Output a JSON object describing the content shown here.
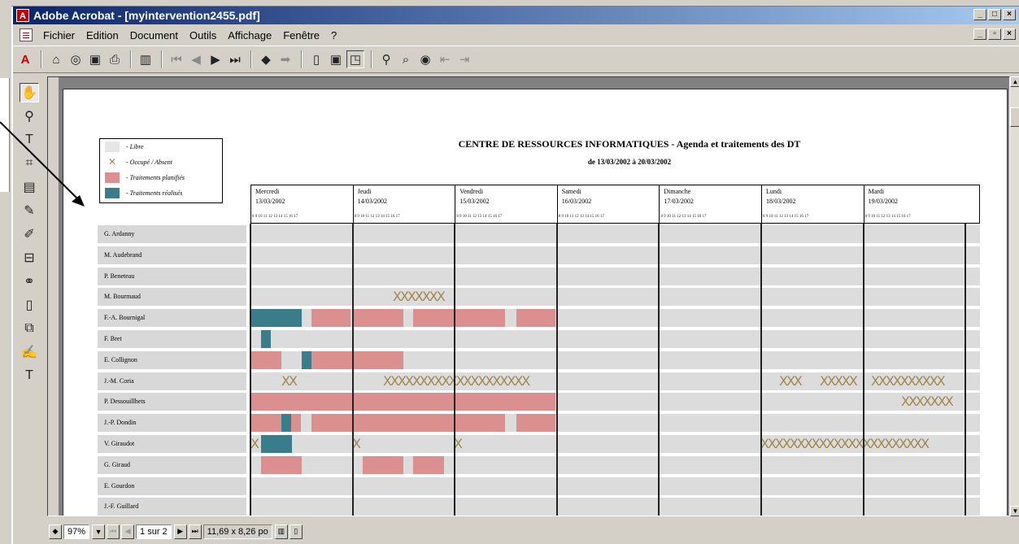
{
  "window": {
    "title": "Adobe Acrobat - [myintervention2455.pdf]",
    "app_icon": "acrobat-icon"
  },
  "menu": [
    "Fichier",
    "Edition",
    "Document",
    "Outils",
    "Affichage",
    "Fenêtre",
    "?"
  ],
  "toolbar": {
    "icons": [
      "acrobat-logo-icon",
      "open-icon",
      "open-web-icon",
      "save-icon",
      "print-icon",
      "show-hide-navigation-icon",
      "first-page-icon",
      "previous-page-icon",
      "next-page-icon",
      "last-page-icon",
      "go-back-icon",
      "go-forward-icon",
      "actual-size-icon",
      "fit-page-icon",
      "fit-width-icon",
      "find-icon",
      "search-icon",
      "search-results-icon",
      "previous-highlight-icon",
      "next-highlight-icon"
    ]
  },
  "tools": [
    "hand-icon",
    "zoom-icon",
    "text-select-icon",
    "crop-icon",
    "article-icon",
    "pencil-icon",
    "highlight-icon",
    "form-icon",
    "link-icon",
    "movie-icon",
    "touchup-icon",
    "signature-icon",
    "touchup-text-icon"
  ],
  "statusbar": {
    "zoom": "97%",
    "page": "1 sur 2",
    "page_size": "11,69 x 8,26 po"
  },
  "document": {
    "title": "CENTRE DE RESSOURCES INFORMATIQUES   -   Agenda et traitements des DT",
    "subtitle": "de 13/03/2002 à 20/03/2002",
    "legend": [
      {
        "label": "- Libre",
        "type": "free",
        "color": "#e6e6e6"
      },
      {
        "label": "- Occupé / Absent",
        "type": "busy",
        "color": "#a08850"
      },
      {
        "label": "- Traitements planifiés",
        "type": "planned",
        "color": "#dc8f8f"
      },
      {
        "label": "- Traitements réalisés",
        "type": "done",
        "color": "#3a7d8a"
      }
    ],
    "hours_scale": "8  9 10 11 12 13 14  15 16 17",
    "days": [
      {
        "name": "Mercredi",
        "date": "13/03/2002"
      },
      {
        "name": "Jeudi",
        "date": "14/03/2002"
      },
      {
        "name": "Vendredi",
        "date": "15/03/2002"
      },
      {
        "name": "Samedi",
        "date": "16/03/2002"
      },
      {
        "name": "Dimanche",
        "date": "17/03/2002"
      },
      {
        "name": "Lundi",
        "date": "18/03/2002"
      },
      {
        "name": "Mardi",
        "date": "19/03/2002"
      }
    ],
    "people": [
      "G. Ardanny",
      "M. Audebrand",
      "P. Beneteau",
      "M. Bourmaud",
      "F.-A. Bournigal",
      "F. Bret",
      "E. Collignon",
      "J.-M. Coria",
      "P. Dessouillhets",
      "J.-P. Dondin",
      "V. Giraudot",
      "G. Giraud",
      "E. Gourdon",
      "J.-F. Guillard"
    ]
  }
}
